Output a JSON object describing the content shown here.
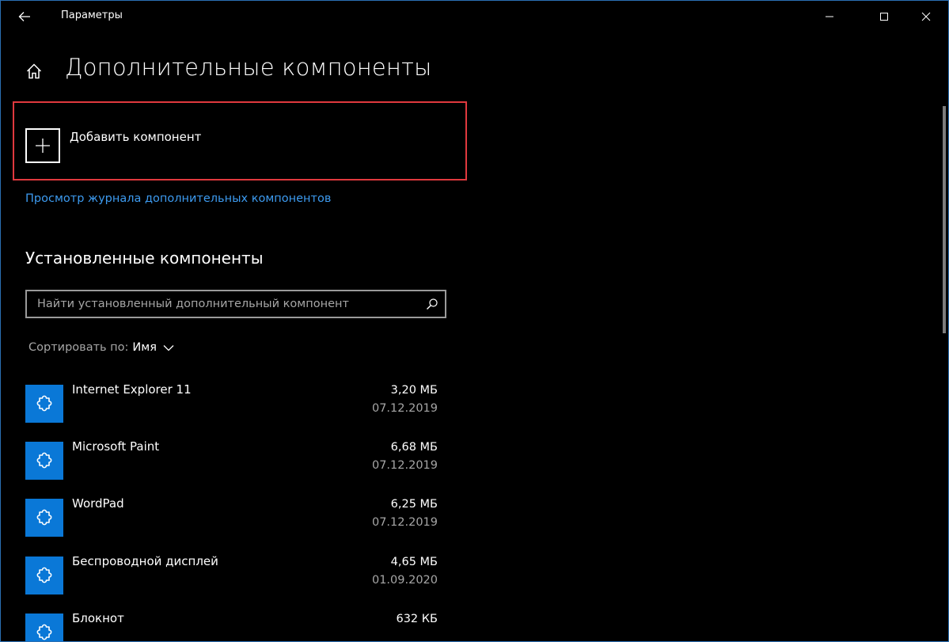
{
  "window": {
    "title": "Параметры"
  },
  "header": {
    "page_title": "Дополнительные компоненты"
  },
  "add_component": {
    "label": "Добавить компонент"
  },
  "history_link": {
    "label": "Просмотр журнала дополнительных компонентов"
  },
  "installed": {
    "title": "Установленные компоненты",
    "search_placeholder": "Найти установленный дополнительный компонент",
    "sort_label": "Сортировать по:",
    "sort_value": "Имя"
  },
  "components": [
    {
      "name": "Internet Explorer 11",
      "size": "3,20 МБ",
      "date": "07.12.2019",
      "icon": "puzzle-icon"
    },
    {
      "name": "Microsoft Paint",
      "size": "6,68 МБ",
      "date": "07.12.2019",
      "icon": "puzzle-icon"
    },
    {
      "name": "WordPad",
      "size": "6,25 МБ",
      "date": "07.12.2019",
      "icon": "puzzle-icon"
    },
    {
      "name": "Беспроводной дисплей",
      "size": "4,65 МБ",
      "date": "01.09.2020",
      "icon": "puzzle-icon"
    },
    {
      "name": "Блокнот",
      "size": "632 КБ",
      "date": "",
      "icon": "puzzle-icon"
    }
  ],
  "colors": {
    "accent": "#0a78d7",
    "link": "#3d9bf0",
    "highlight_frame": "#e0393e",
    "background": "#000000"
  }
}
